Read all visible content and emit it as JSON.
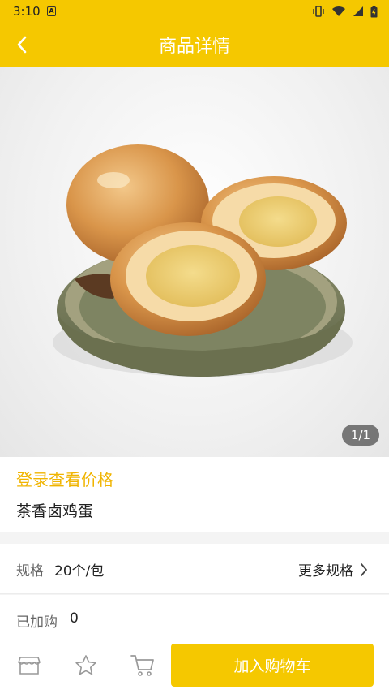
{
  "status_bar": {
    "time": "3:10",
    "badge": "A"
  },
  "header": {
    "title": "商品详情",
    "back_icon": "back-arrow-icon"
  },
  "gallery": {
    "pager": "1/1"
  },
  "product": {
    "price_login_text": "登录查看价格",
    "name": "茶香卤鸡蛋"
  },
  "spec": {
    "label": "规格",
    "value": "20个/包",
    "more_label": "更多规格"
  },
  "purchased": {
    "label": "已加购",
    "count": "0"
  },
  "bottom_bar": {
    "add_to_cart_label": "加入购物车"
  },
  "colors": {
    "brand": "#f5c800",
    "price_text": "#f0b400"
  }
}
